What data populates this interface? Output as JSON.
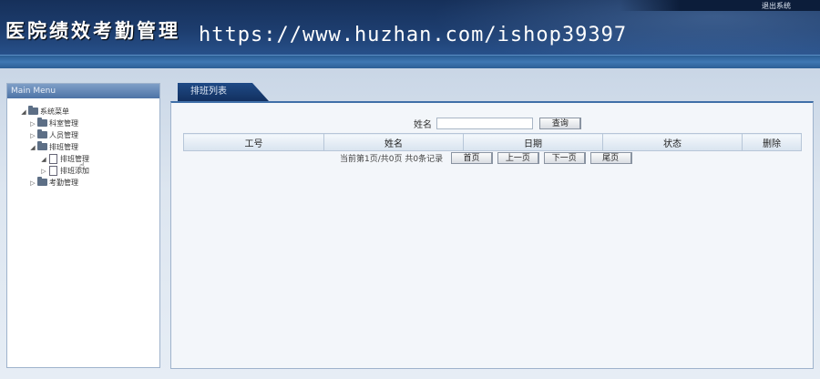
{
  "header": {
    "title": "医院绩效考勤管理",
    "watermark": "https://www.huzhan.com/ishop39397",
    "logout": "退出系统"
  },
  "sidebar": {
    "title": "Main Menu",
    "tree": {
      "root": "系统菜单",
      "items": [
        {
          "label": "科室管理"
        },
        {
          "label": "人员管理"
        },
        {
          "label": "排班管理",
          "children": [
            {
              "label": "排班管理"
            },
            {
              "label": "排班添加"
            }
          ]
        },
        {
          "label": "考勤管理"
        }
      ]
    }
  },
  "main": {
    "tab": "排班列表",
    "search": {
      "label": "姓名",
      "value": "",
      "button": "查询"
    },
    "table": {
      "headers": [
        "工号",
        "姓名",
        "日期",
        "状态",
        "删除"
      ]
    },
    "pager": {
      "info": "当前第1页/共0页  共0条记录",
      "first": "首页",
      "prev": "上一页",
      "next": "下一页",
      "last": "尾页"
    }
  },
  "colors": {
    "header_bg": "#1d3d6e",
    "accent": "#3f6fa8",
    "panel_bg": "#f3f6fa"
  }
}
